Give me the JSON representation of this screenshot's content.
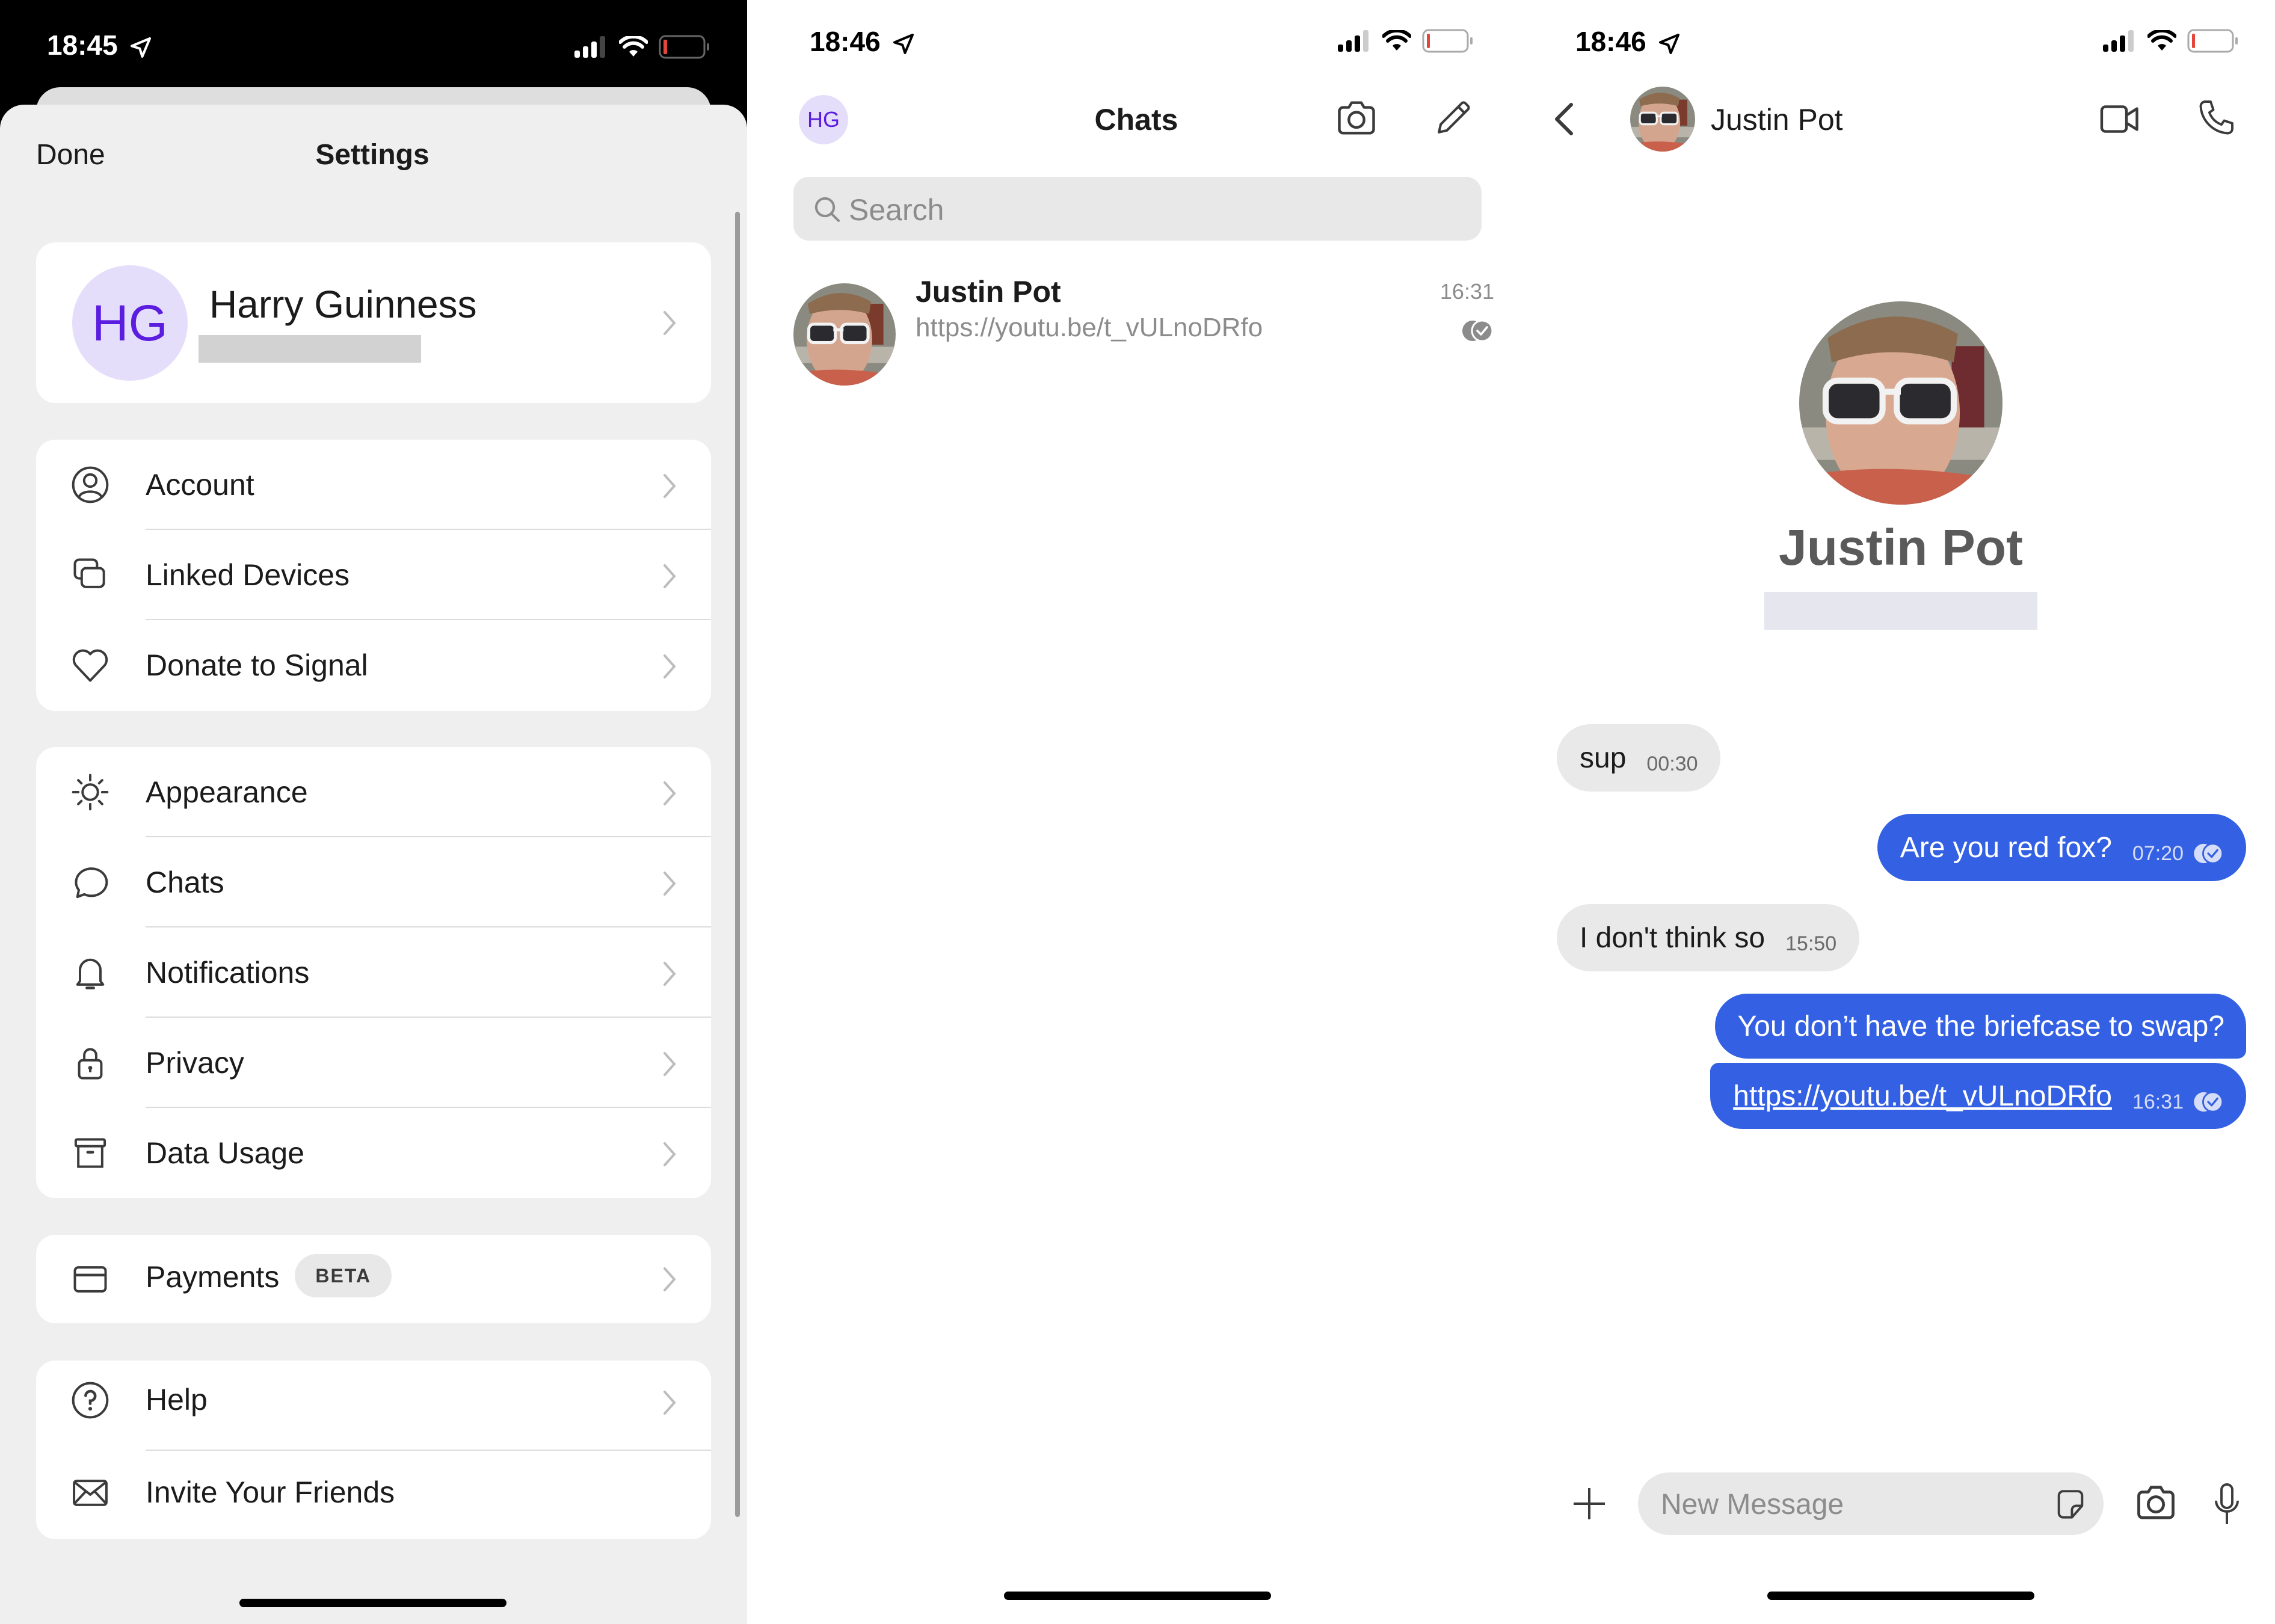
{
  "settings_panel": {
    "status_bar": {
      "time": "18:45",
      "battery_level_pct": 10
    },
    "header": {
      "done_label": "Done",
      "title": "Settings"
    },
    "profile": {
      "initials": "HG",
      "name": "Harry Guinness",
      "phone_redacted": true
    },
    "groups": [
      {
        "items": [
          {
            "label": "Account",
            "icon": "account-icon",
            "chevron": true
          },
          {
            "label": "Linked Devices",
            "icon": "linked-devices-icon",
            "chevron": true
          },
          {
            "label": "Donate to Signal",
            "icon": "heart-icon",
            "chevron": true
          }
        ]
      },
      {
        "items": [
          {
            "label": "Appearance",
            "icon": "sun-icon",
            "chevron": true
          },
          {
            "label": "Chats",
            "icon": "chat-bubble-icon",
            "chevron": true
          },
          {
            "label": "Notifications",
            "icon": "bell-icon",
            "chevron": true
          },
          {
            "label": "Privacy",
            "icon": "lock-icon",
            "chevron": true
          },
          {
            "label": "Data Usage",
            "icon": "archive-box-icon",
            "chevron": true
          }
        ]
      },
      {
        "items": [
          {
            "label": "Payments",
            "badge": "BETA",
            "icon": "credit-card-icon",
            "chevron": true
          }
        ]
      },
      {
        "items": [
          {
            "label": "Help",
            "icon": "help-icon",
            "chevron": true
          },
          {
            "label": "Invite Your Friends",
            "icon": "envelope-icon",
            "chevron": false
          }
        ]
      }
    ]
  },
  "chats_panel": {
    "status_bar": {
      "time": "18:46",
      "battery_level_pct": 10
    },
    "header": {
      "avatar_initials": "HG",
      "title": "Chats"
    },
    "search": {
      "placeholder": "Search"
    },
    "conversations": [
      {
        "name": "Justin Pot",
        "preview": "https://youtu.be/t_vULnoDRfo",
        "time": "16:31",
        "status": "read"
      }
    ]
  },
  "conversation_panel": {
    "status_bar": {
      "time": "18:46",
      "battery_level_pct": 10
    },
    "header": {
      "contact_name": "Justin Pot"
    },
    "profile": {
      "name": "Justin Pot",
      "phone_redacted": true
    },
    "messages": [
      {
        "direction": "incoming",
        "text": "sup",
        "time": "00:30"
      },
      {
        "direction": "outgoing",
        "text": "Are you red fox?",
        "time": "07:20",
        "status": "read"
      },
      {
        "direction": "incoming",
        "text": "I don't think so",
        "time": "15:50"
      },
      {
        "direction": "outgoing",
        "text": "You don’t have the briefcase to swap?",
        "time": ""
      },
      {
        "direction": "outgoing",
        "text": "https://youtu.be/t_vULnoDRfo",
        "time": "16:31",
        "status": "read",
        "is_link": true
      }
    ],
    "composer": {
      "placeholder": "New Message"
    }
  },
  "colors": {
    "accent_purple": "#5b1de0",
    "avatar_bg": "#e5defb",
    "outgoing_bubble": "#3461e3",
    "incoming_bubble": "#e9e9e9",
    "battery_low": "#e5463b"
  }
}
